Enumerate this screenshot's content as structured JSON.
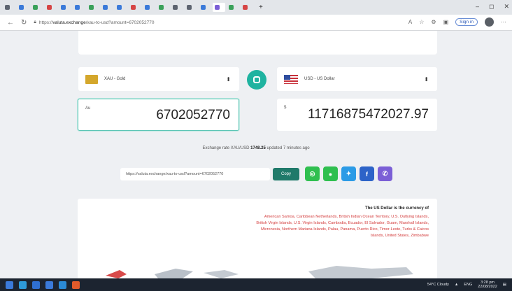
{
  "browser": {
    "tabs": [
      {
        "label": "",
        "color": "#5d6470"
      },
      {
        "label": "",
        "color": "#3b7ad9"
      },
      {
        "label": "",
        "color": "#3aa15a"
      },
      {
        "label": "",
        "color": "#d64545"
      },
      {
        "label": "",
        "color": "#3b7ad9"
      },
      {
        "label": "",
        "color": "#3b7ad9"
      },
      {
        "label": "",
        "color": "#3aa15a"
      },
      {
        "label": "",
        "color": "#3b7ad9"
      },
      {
        "label": "",
        "color": "#3b7ad9"
      },
      {
        "label": "",
        "color": "#d64545"
      },
      {
        "label": "",
        "color": "#3b7ad9"
      },
      {
        "label": "",
        "color": "#3aa15a"
      },
      {
        "label": "",
        "color": "#5d6470"
      },
      {
        "label": "",
        "color": "#5d6470"
      },
      {
        "label": "",
        "color": "#3b7ad9"
      },
      {
        "label": "",
        "color": "#7b5fd6"
      },
      {
        "label": "",
        "color": "#3aa15a"
      },
      {
        "label": "",
        "color": "#d64545"
      }
    ],
    "url_prefix": "https://",
    "url_domain": "valuta.exchange",
    "url_path": "/xau-to-usd?amount=6702052770",
    "sign_in": "Sign in"
  },
  "converter": {
    "from_currency": "XAU - Gold",
    "to_currency": "USD - US Dollar",
    "from_symbol": "Au",
    "to_symbol": "$",
    "from_amount": "6702052770",
    "to_amount": "11716875472027.97",
    "rate_prefix": "Exchange rate XAU/USD",
    "rate_value": "1748.25",
    "rate_suffix": "updated 7 minutes ago",
    "share_url": "https://valuta.exchange/xau-to-usd?amount=6702052770",
    "copy_label": "Copy"
  },
  "social": [
    {
      "name": "whatsapp-icon",
      "color": "#2fbf4f",
      "glyph": "◎"
    },
    {
      "name": "line-icon",
      "color": "#2fbf4f",
      "glyph": "●"
    },
    {
      "name": "twitter-icon",
      "color": "#2b9be6",
      "glyph": "✦"
    },
    {
      "name": "facebook-icon",
      "color": "#2d63c8",
      "glyph": "f"
    },
    {
      "name": "viber-icon",
      "color": "#7b5fd6",
      "glyph": "✆"
    }
  ],
  "info": {
    "title": "The US Dollar is the currency of",
    "countries": "American Samoa, Caribbean Netherlands, British Indian Ocean Territory, U.S. Outlying Islands, British Virgin Islands, U.S. Virgin Islands, Cambodia, Ecuador, El Salvador, Guam, Marshall Islands, Micronesia, Northern Mariana Islands, Palau, Panama, Puerto Rico, Timor-Leste, Turks & Caicos Islands, United States, Zimbabwe"
  },
  "taskbar": {
    "weather": "54°C Cloudy",
    "time": "3:28 pm",
    "date": "22/08/2022",
    "lang": "ENG"
  }
}
